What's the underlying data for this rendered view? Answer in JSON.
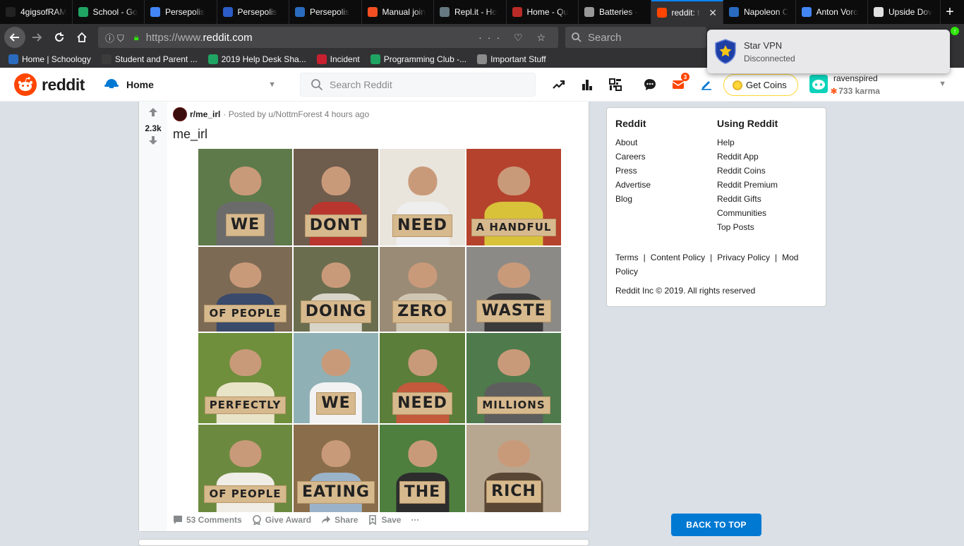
{
  "browser": {
    "tabs": [
      {
        "label": "4gigsofRAM",
        "icon_color": "#222222",
        "icon": "penguin-icon"
      },
      {
        "label": "School - Go",
        "icon_color": "#1fa463",
        "icon": "drive-icon"
      },
      {
        "label": "Persepolis",
        "icon_color": "#4285f4",
        "icon": "docs-icon"
      },
      {
        "label": "Persepolis",
        "icon_color": "#2c5cc5",
        "icon": "quizlet-icon"
      },
      {
        "label": "Persepolis",
        "icon_color": "#2a6bbf",
        "icon": "schoology-icon"
      },
      {
        "label": "Manual join",
        "icon_color": "#f25022",
        "icon": "microsoft-icon"
      },
      {
        "label": "Repl.it - Ho",
        "icon_color": "#667881",
        "icon": "replit-icon"
      },
      {
        "label": "Home - Qu",
        "icon_color": "#b92b27",
        "icon": "quora-icon"
      },
      {
        "label": "Batteries -",
        "icon_color": "#999999",
        "icon": "apple-icon"
      },
      {
        "label": "reddit: t",
        "icon_color": "#ff4500",
        "icon": "reddit-icon",
        "active": true
      },
      {
        "label": "Napoleon C",
        "icon_color": "#2a6bbf",
        "icon": "schoology-icon"
      },
      {
        "label": "Anton Voro",
        "icon_color": "#4285f4",
        "icon": "docs-icon"
      },
      {
        "label": "Upside Dov",
        "icon_color": "#e0e0e0",
        "icon": "page-icon"
      }
    ],
    "url_prefix": "https://www.",
    "url_domain": "reddit.com",
    "search_placeholder": "Search",
    "bookmarks": [
      {
        "label": "Home | Schoology",
        "icon": "schoology-icon"
      },
      {
        "label": "Student and Parent ...",
        "icon": "pearson-icon"
      },
      {
        "label": "2019 Help Desk Sha...",
        "icon": "drive-icon"
      },
      {
        "label": "Incident",
        "icon": "incident-icon"
      },
      {
        "label": "Programming Club -...",
        "icon": "drive-icon"
      },
      {
        "label": "Important Stuff",
        "icon": "folder-icon"
      }
    ]
  },
  "vpn": {
    "title": "Star VPN",
    "status": "Disconnected"
  },
  "reddit": {
    "wordmark": "reddit",
    "feed_label": "Home",
    "search_placeholder": "Search Reddit",
    "mail_badge": "3",
    "get_coins": "Get Coins",
    "username": "ravenspired",
    "karma": "733 karma"
  },
  "post": {
    "votes": "2.3k",
    "subreddit": "r/me_irl",
    "posted_by": "· Posted by u/NottmForest 4 hours ago",
    "title": "me_irl",
    "signs": [
      {
        "text": "WE",
        "bg": "#5e7a4a",
        "shirt": "#6b6b6b"
      },
      {
        "text": "DONT",
        "bg": "#6e5c4d",
        "shirt": "#b8362e"
      },
      {
        "text": "NEED",
        "bg": "#e9e4dc",
        "shirt": "#eeeeee"
      },
      {
        "text": "A HANDFUL",
        "bg": "#b5422d",
        "shirt": "#d8c23a",
        "small": true
      },
      {
        "text": "OF PEOPLE",
        "bg": "#7d6a55",
        "shirt": "#3a4a6b",
        "small": true
      },
      {
        "text": "DOING",
        "bg": "#6a6e4f",
        "shirt": "#d9d4c8"
      },
      {
        "text": "ZERO",
        "bg": "#9a8b76",
        "shirt": "#cfc5b3"
      },
      {
        "text": "WASTE",
        "bg": "#8b8a86",
        "shirt": "#3a3a3a"
      },
      {
        "text": "PERFECTLY",
        "bg": "#6f8f3c",
        "shirt": "#e8e4c8",
        "small": true
      },
      {
        "text": "WE",
        "bg": "#8fb0b5",
        "shirt": "#f2f2f2"
      },
      {
        "text": "NEED",
        "bg": "#5b7e3a",
        "shirt": "#c25a3b"
      },
      {
        "text": "MILLIONS",
        "bg": "#4f7a4c",
        "shirt": "#5e5e5e",
        "small": true
      },
      {
        "text": "OF PEOPLE",
        "bg": "#6c8a3f",
        "shirt": "#f0ede6",
        "small": true
      },
      {
        "text": "EATING",
        "bg": "#8a6d4b",
        "shirt": "#9bb3c9"
      },
      {
        "text": "THE",
        "bg": "#4e7f3f",
        "shirt": "#2d2d2d"
      },
      {
        "text": "RICH",
        "bg": "#b8a790",
        "shirt": "#5a4634"
      }
    ],
    "actions": {
      "comments": "53 Comments",
      "award": "Give Award",
      "share": "Share",
      "save": "Save",
      "more": "···"
    }
  },
  "sidebar": {
    "col1_title": "Reddit",
    "col1_links": [
      "About",
      "Careers",
      "Press",
      "Advertise",
      "Blog"
    ],
    "col2_title": "Using Reddit",
    "col2_links": [
      "Help",
      "Reddit App",
      "Reddit Coins",
      "Reddit Premium",
      "Reddit Gifts",
      "Communities",
      "Top Posts"
    ],
    "legal": [
      "Terms",
      "Content Policy",
      "Privacy Policy",
      "Mod Policy"
    ],
    "copyright": "Reddit Inc © 2019. All rights reserved"
  },
  "back_to_top": "BACK TO TOP"
}
